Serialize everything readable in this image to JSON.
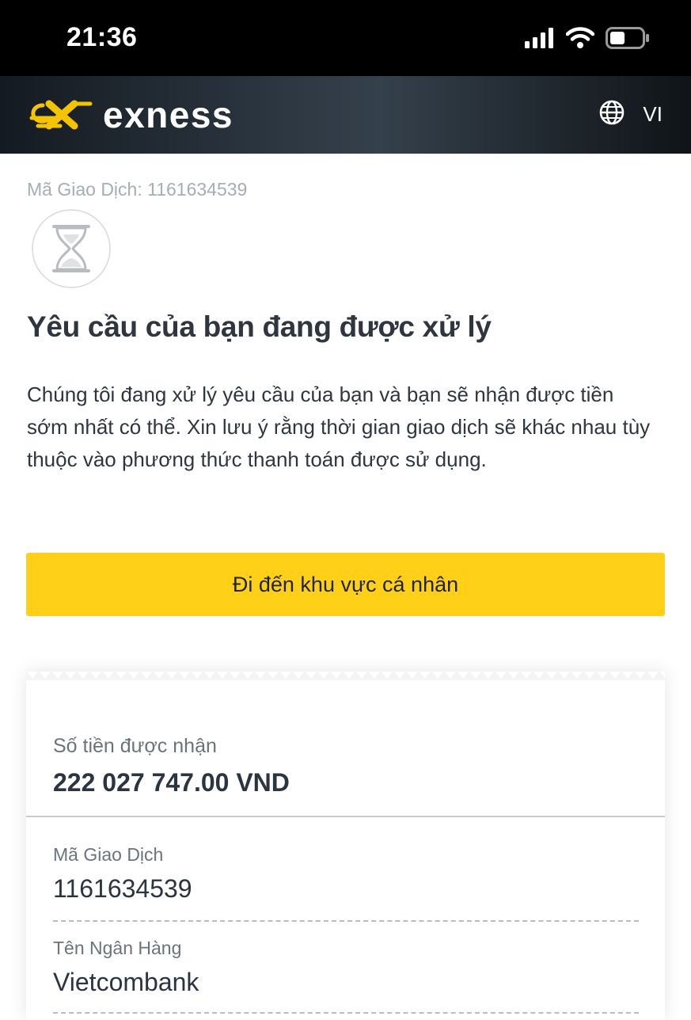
{
  "status_bar": {
    "time": "21:36",
    "icons": [
      "cellular-signal-icon",
      "wifi-icon",
      "battery-icon"
    ]
  },
  "header": {
    "brand": "exness",
    "language": "VI",
    "language_icon": "globe-icon"
  },
  "transaction_ref": "Mã Giao Dịch: 1161634539",
  "status_icon": "hourglass-icon",
  "title": "Yêu cầu của bạn đang được xử lý",
  "description": "Chúng tôi đang xử lý yêu cầu của bạn và bạn sẽ nhận được tiền sớm nhất có thể. Xin lưu ý rằng thời gian giao dịch sẽ khác nhau tùy thuộc vào phương thức thanh toán được sử dụng.",
  "primary_button": "Đi đến khu vực cá nhân",
  "receipt": {
    "amount_label": "Số tiền được nhận",
    "amount_value": "222 027 747.00 VND",
    "details": [
      {
        "label": "Mã Giao Dịch",
        "value": "1161634539"
      },
      {
        "label": "Tên Ngân Hàng",
        "value": "Vietcombank"
      }
    ]
  },
  "colors": {
    "accent_yellow": "#ffd017",
    "logo_yellow": "#f5c400",
    "status_bar_bg": "#000000",
    "header_bg": "#2f3a45",
    "text_dark": "#2f3640",
    "text_muted": "#a7adb4"
  }
}
